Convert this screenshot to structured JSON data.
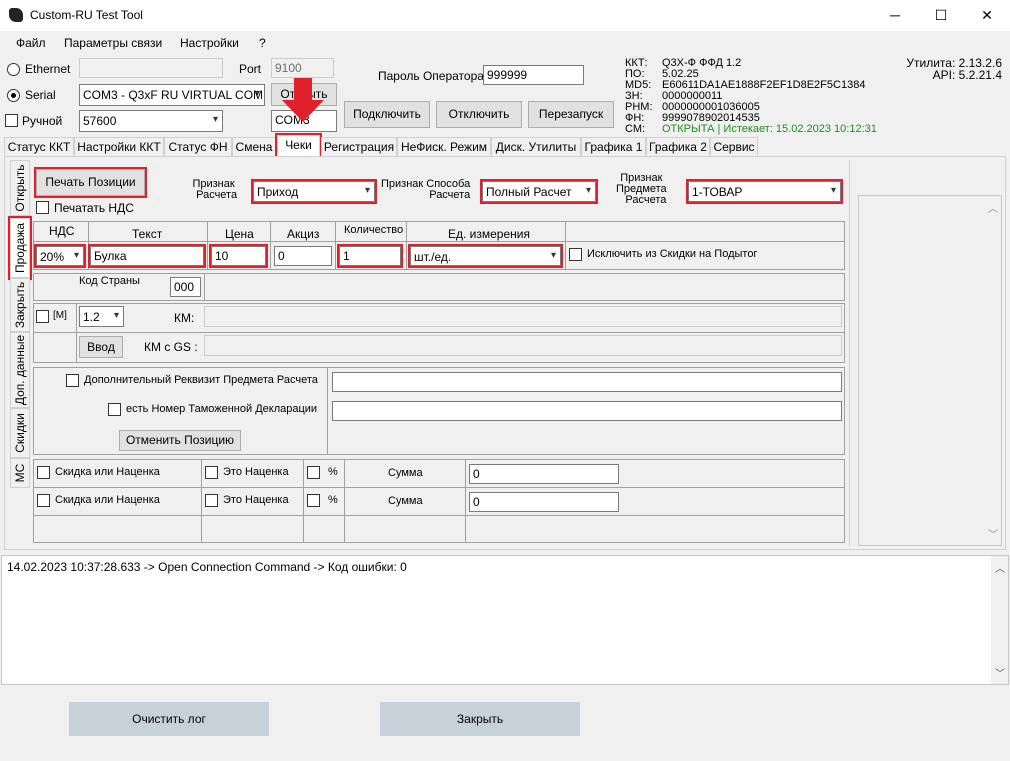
{
  "window": {
    "title": "Custom-RU Test Tool",
    "minimize": "─",
    "maximize": "☐",
    "close": "✕"
  },
  "menu": [
    "Файл",
    "Параметры связи",
    "Настройки",
    "?"
  ],
  "connection": {
    "ethernet_label": "Ethernet",
    "port_label": "Port",
    "port_value": "9100",
    "serial_label": "Serial",
    "serial_value": "COM3 - Q3xF RU VIRTUAL COM (",
    "open_button": "Открыть",
    "manual_label": "Ручной",
    "baud_value": "57600",
    "com_value": "COM3",
    "password_label": "Пароль Оператора",
    "password_value": "999999",
    "connect_button": "Подключить",
    "disconnect_button": "Отключить",
    "restart_button": "Перезапуск"
  },
  "kkt_info": {
    "labels": [
      "ККТ:",
      "ПО:",
      "MD5:",
      "ЗН:",
      "РНМ:",
      "ФН:",
      "СМ:"
    ],
    "values": [
      "Q3X-Ф ФФД 1.2",
      "5.02.25",
      "E60611DA1AE1888F2EF1D8E2F5C1384",
      "0000000011",
      "0000000001036005",
      "9999078902014535",
      "ОТКРЫТА | Истекает: 15.02.2023 10:12:31"
    ],
    "status_color": "#1a8f1a"
  },
  "version": {
    "utility": "Утилита: 2.13.2.6",
    "api": "API: 5.2.21.4"
  },
  "tabs": [
    "Статус ККТ",
    "Настройки ККТ",
    "Статус ФН",
    "Смена",
    "Чеки",
    "Регистрация",
    "НеФиск. Режим",
    "Диск. Утилиты",
    "Графика 1",
    "Графика 2",
    "Сервис"
  ],
  "side_tabs": [
    "Открыть",
    "Продажа",
    "Закрыть",
    "Доп. данные",
    "Скидки",
    "МС"
  ],
  "sale": {
    "print_position_button": "Печать Позиции",
    "print_vat_label": "Печатать НДС",
    "calc_sign_label": "Признак\nРасчета",
    "calc_sign_value": "Приход",
    "method_label": "Признак Способа\nРасчета",
    "method_value": "Полный Расчет",
    "subject_label": "Признак\nПредмета\nРасчета",
    "subject_value": "1-ТОВАР",
    "headers": [
      "НДС",
      "Текст",
      "Цена",
      "Акциз",
      "Количество",
      "Ед. измерения"
    ],
    "vat_value": "20%",
    "text_value": "Булка",
    "price_value": "10",
    "excise_value": "0",
    "qty_value": "1",
    "unit_value": "шт./ед.",
    "exclude_label": "Исключить из Скидки на Подытог",
    "country_code_label": "Код Страны",
    "country_code_value": "000",
    "m_label": "[M]",
    "version_value": "1.2",
    "km_label": "КМ:",
    "enter_button": "Ввод",
    "km_gs_label": "КМ с GS :",
    "add_req_label": "Дополнительный Реквизит Предмета Расчета",
    "customs_label": "есть Номер Таможенной Декларации",
    "cancel_position_button": "Отменить Позицию",
    "discounts": [
      {
        "label": "Скидка или Наценка",
        "markup_label": "Это Наценка",
        "pct_label": "%",
        "sum_label": "Сумма",
        "sum_value": "0"
      },
      {
        "label": "Скидка или Наценка",
        "markup_label": "Это Наценка",
        "pct_label": "%",
        "sum_label": "Сумма",
        "sum_value": "0"
      }
    ]
  },
  "log": {
    "line": "14.02.2023 10:37:28.633 -> Open Connection Command -> Код ошибки: 0"
  },
  "bottom": {
    "clear_log_button": "Очистить лог",
    "close_button": "Закрыть"
  },
  "accent_red": "#e0202a"
}
